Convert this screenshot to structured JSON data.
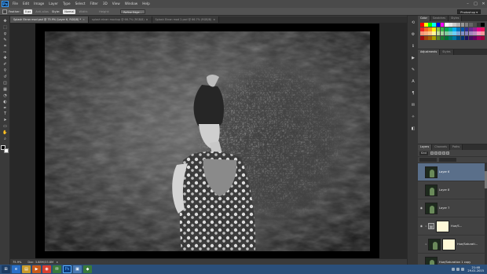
{
  "app": {
    "logo": "Ps"
  },
  "menu": [
    "File",
    "Edit",
    "Image",
    "Layer",
    "Type",
    "Select",
    "Filter",
    "3D",
    "View",
    "Window",
    "Help"
  ],
  "window_controls": {
    "minimize": "–",
    "maximize": "□",
    "close": "✕"
  },
  "options": {
    "feather_label": "Feather:",
    "feather_value": "0 px",
    "anti_alias": "Anti-alias",
    "style_label": "Style:",
    "style_value": "Normal",
    "width_label": "Width:",
    "height_label": "Height:",
    "refine_edge": "Refine Edge...",
    "workspace": "Photoshop ▾"
  },
  "tabs": [
    {
      "label": "Splash Ekran mod.psd @ 75.9% (Layer 6, RGB/8) *",
      "active": true
    },
    {
      "label": "splash ekran mockup @ 66.7% (RGB/8)",
      "active": false
    },
    {
      "label": "Splash Ekran mod 2.psd @ 66.7% (RGB/8)",
      "active": false
    }
  ],
  "tools": [
    "move-icon",
    "marquee-icon",
    "lasso-icon",
    "quick-select-icon",
    "crop-icon",
    "eyedropper-icon",
    "healing-icon",
    "brush-icon",
    "stamp-icon",
    "history-brush-icon",
    "eraser-icon",
    "gradient-icon",
    "blur-icon",
    "dodge-icon",
    "pen-icon",
    "type-icon",
    "path-select-icon",
    "shape-icon",
    "hand-icon",
    "zoom-icon"
  ],
  "tool_glyphs": [
    "✥",
    "⬚",
    "ϙ",
    "✎",
    "⌗",
    "✑",
    "✚",
    "✐",
    "⚲",
    "↺",
    "◫",
    "▦",
    "◔",
    "◐",
    "✒",
    "T",
    "➤",
    "▭",
    "✋",
    "⌕"
  ],
  "status": {
    "zoom": "75.9%",
    "doc": "Doc: 3.88M/33.8M",
    "arrow": "▸"
  },
  "dock": [
    "history-icon",
    "properties-icon",
    "info-icon",
    "actions-icon",
    "brush-presets-icon",
    "character-icon",
    "paragraph-icon",
    "notes-icon",
    "paths-icon",
    "channels-icon"
  ],
  "dock_glyphs": [
    "⟲",
    "⚙",
    "ℹ",
    "▶",
    "✎",
    "A",
    "¶",
    "✉",
    "✧",
    "◧"
  ],
  "panels": {
    "color_tabs": [
      "Color",
      "Swatches",
      "Styles"
    ],
    "adjust_tabs": [
      "Adjustments",
      "Styles"
    ],
    "layer_tabs": [
      "Layers",
      "Channels",
      "Paths"
    ],
    "kind_label": "Kind",
    "swatch_colors": [
      "#ff0000",
      "#ffff00",
      "#00ff00",
      "#00ffff",
      "#0000ff",
      "#ff00ff",
      "#ffffff",
      "#e6e6e6",
      "#cccccc",
      "#b3b3b3",
      "#999999",
      "#808080",
      "#666666",
      "#4d4d4d",
      "#333333",
      "#000000",
      "#ee1d24",
      "#f26522",
      "#f7941d",
      "#fff200",
      "#8dc63f",
      "#39b54a",
      "#00a651",
      "#00a99d",
      "#00aeef",
      "#0072bc",
      "#0054a6",
      "#2e3192",
      "#662d91",
      "#92278f",
      "#ec008c",
      "#ed145b",
      "#f7977a",
      "#f9ad81",
      "#fdc68a",
      "#fff79a",
      "#c4df9b",
      "#a3d39c",
      "#82ca9d",
      "#7accc8",
      "#6dcff6",
      "#7da7d9",
      "#8393ca",
      "#8781bd",
      "#a187be",
      "#bd8cbf",
      "#f49ac2",
      "#f6989d",
      "#9e0b0f",
      "#a0410d",
      "#a36209",
      "#aba000",
      "#598527",
      "#1a7b30",
      "#007236",
      "#00746b",
      "#0076a3",
      "#004b80",
      "#003471",
      "#1b1464",
      "#440e62",
      "#630460",
      "#9e005d",
      "#9e0039"
    ]
  },
  "layers": [
    {
      "name": "Layer 6",
      "type": "pixel",
      "selected": true
    },
    {
      "name": "Layer 8",
      "type": "pixel",
      "selected": false
    },
    {
      "name": "Layer 7",
      "type": "pixel",
      "selected": false
    },
    {
      "name": "Hue/S...",
      "type": "adjustment",
      "selected": false
    },
    {
      "name": "Hue/Saturati...",
      "type": "mask",
      "selected": false
    },
    {
      "name": "Hue/Saturation 1 copy",
      "type": "pixel",
      "selected": false
    }
  ],
  "taskbar": {
    "buttons": [
      "start-icon",
      "ie-icon",
      "folder-icon",
      "media-icon",
      "chrome-icon",
      "app-icon",
      "photoshop-icon",
      "app2-icon",
      "app3-icon"
    ],
    "clock_time": "21:48",
    "clock_date": "29.01.2015"
  }
}
